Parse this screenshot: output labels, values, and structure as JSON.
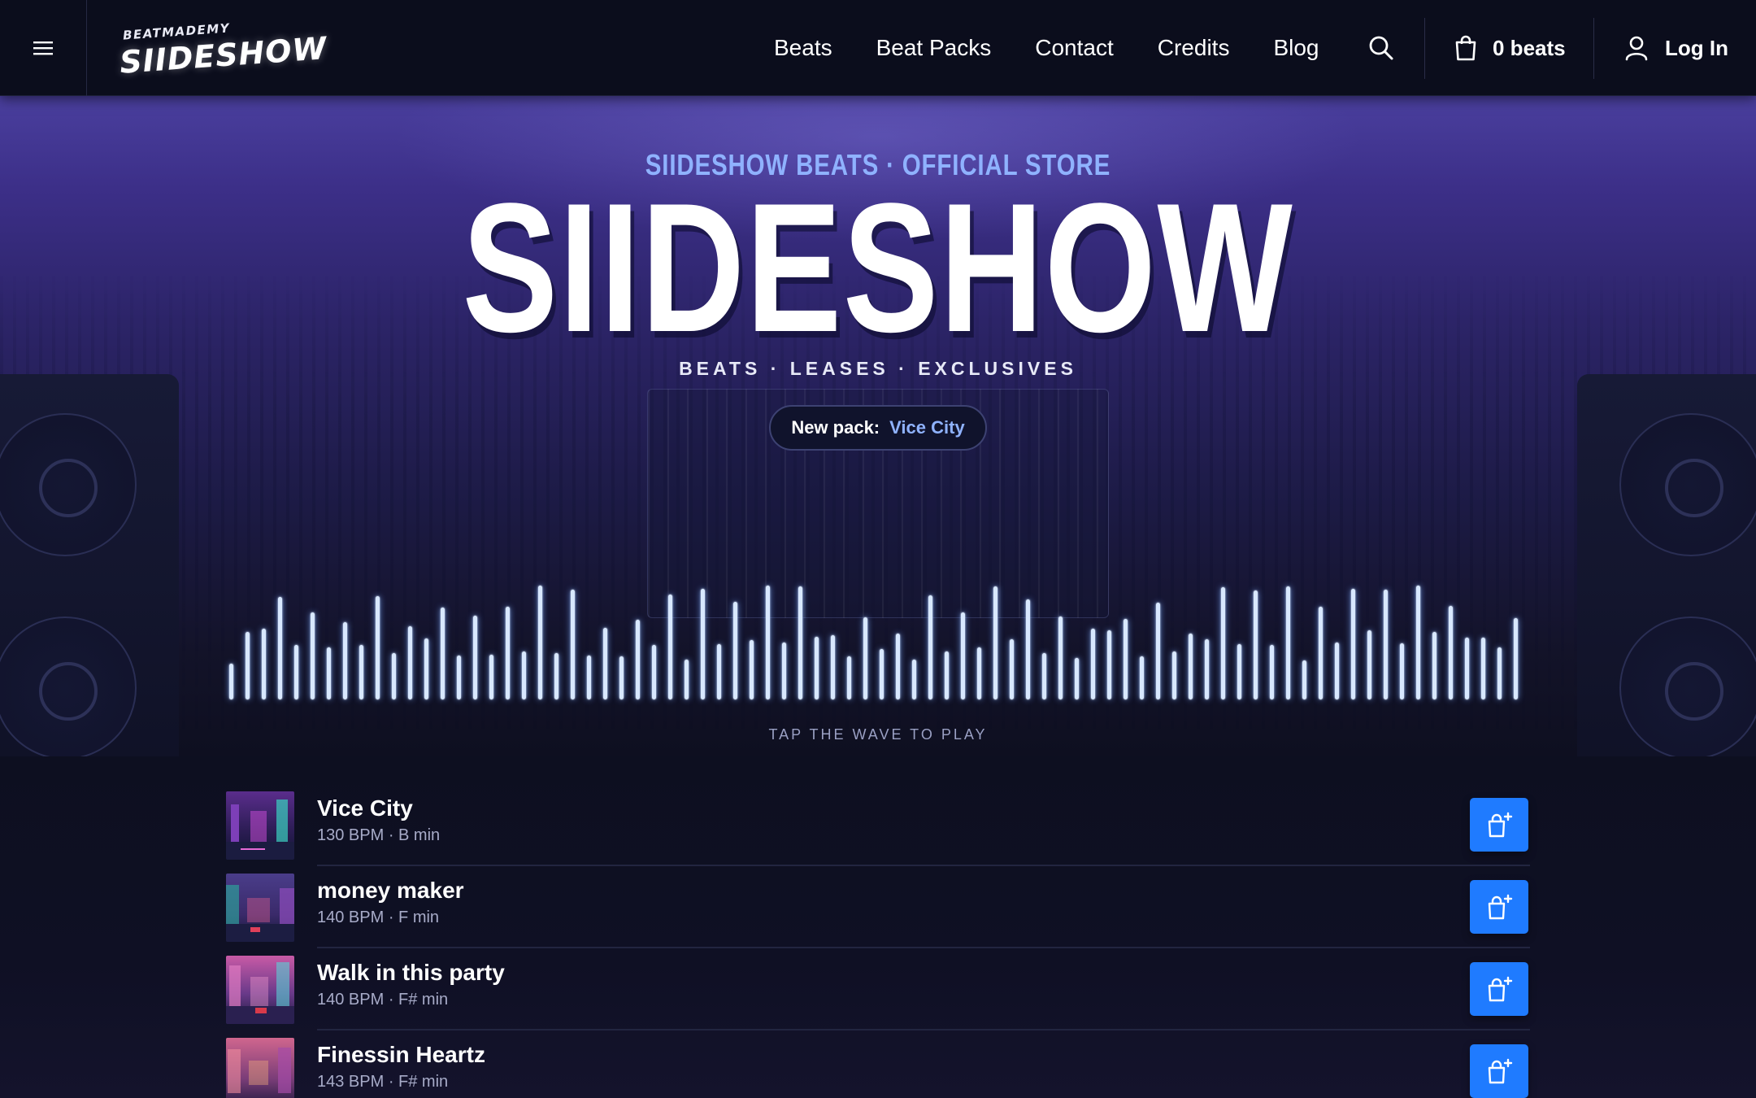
{
  "brand": {
    "logo_small": "BEATMADEMY",
    "logo_big": "SIIDESHOW"
  },
  "nav": {
    "links": [
      "Beats",
      "Beat Packs",
      "Contact",
      "Credits",
      "Blog"
    ],
    "cart_label": "0 beats",
    "login_label": "Log In"
  },
  "hero": {
    "eyebrow": "SIIDESHOW BEATS · OFFICIAL STORE",
    "title": "SIIDESHOW",
    "tagline": "BEATS · LEASES · EXCLUSIVES",
    "pill_label": "New pack:",
    "pill_value": "Vice City",
    "wave_hint": "TAP THE WAVE TO PLAY",
    "wave_levels": [
      0.19,
      0.52,
      0.55,
      0.88,
      0.38,
      0.72,
      0.36,
      0.62,
      0.38,
      0.89,
      0.3,
      0.58,
      0.45,
      0.77,
      0.27,
      0.69,
      0.28,
      0.78,
      0.31,
      1.0,
      0.3,
      0.96,
      0.27,
      0.56,
      0.26,
      0.64,
      0.38,
      0.91,
      0.23,
      0.97,
      0.39,
      0.83,
      0.43,
      1.0,
      0.41,
      0.99,
      0.47,
      0.48,
      0.26,
      0.67,
      0.34,
      0.5,
      0.23,
      0.9,
      0.31,
      0.72,
      0.36,
      0.99,
      0.44,
      0.86,
      0.3,
      0.68,
      0.25,
      0.55,
      0.53,
      0.65,
      0.26,
      0.82,
      0.31,
      0.5,
      0.44,
      0.98,
      0.39,
      0.95,
      0.38,
      0.99,
      0.22,
      0.78,
      0.41,
      0.97,
      0.53,
      0.96,
      0.4,
      1.0,
      0.52,
      0.79,
      0.46,
      0.46,
      0.36,
      0.66
    ],
    "accent_color": "#8fb2ff"
  },
  "tracks": [
    {
      "title": "Vice City",
      "meta": "130 BPM · B min"
    },
    {
      "title": "money maker",
      "meta": "140 BPM · F min"
    },
    {
      "title": "Walk in this party",
      "meta": "140 BPM · F# min"
    },
    {
      "title": "Finessin Heartz",
      "meta": "143 BPM · F# min"
    }
  ],
  "colors": {
    "buy_button": "#1f7bff",
    "nav_bg": "#0b0d1c"
  },
  "icons": {
    "menu": "menu-icon",
    "search": "search-icon",
    "cart": "shopping-bag-icon",
    "user": "user-icon",
    "buy": "bag-plus-icon"
  }
}
